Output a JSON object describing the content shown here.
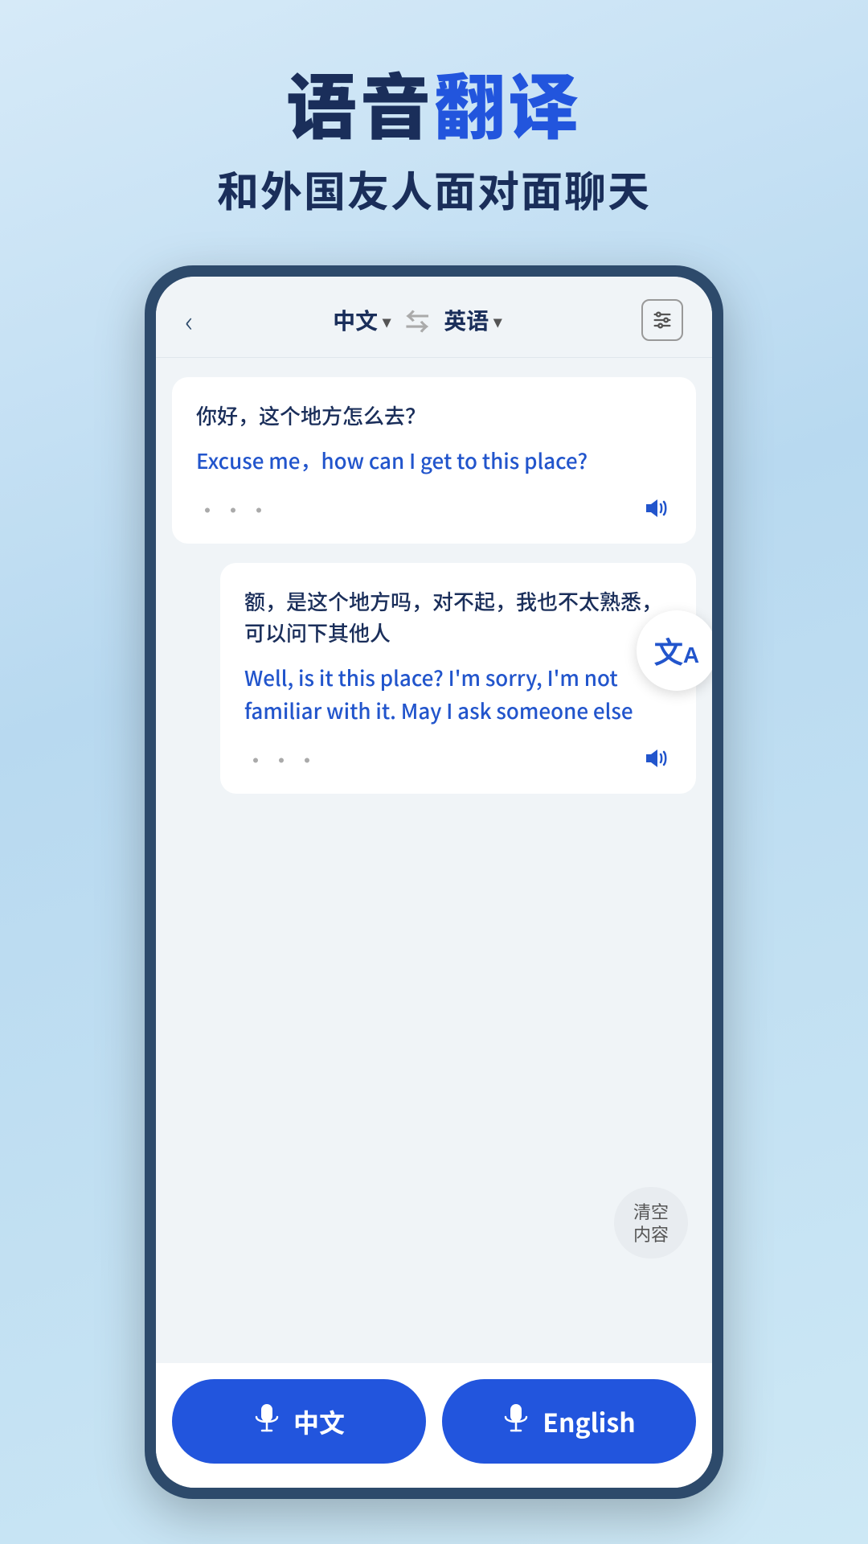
{
  "page": {
    "title": {
      "part1": "语音",
      "part2": "翻译",
      "subtitle": "和外国友人面对面聊天"
    }
  },
  "topBar": {
    "back_label": "‹",
    "lang1": "中文",
    "lang1_arrow": "▾",
    "lang2": "英语",
    "lang2_arrow": "▾",
    "swap_symbol": "⇄"
  },
  "messages": [
    {
      "id": 1,
      "original": "你好，这个地方怎么去？",
      "translated": "Excuse me，how can I get to this place?",
      "dots": "···",
      "alignment": "left"
    },
    {
      "id": 2,
      "original": "额，是这个地方吗，对不起，我也不太熟悉，可以问下其他人",
      "translated": "Well, is it this place? I'm sorry, I'm not familiar with it. May I ask someone else",
      "dots": "···",
      "alignment": "right"
    }
  ],
  "clearBtn": {
    "line1": "清空",
    "line2": "内容"
  },
  "bottomBtns": [
    {
      "id": "chinese",
      "label": "中文"
    },
    {
      "id": "english",
      "label": "English"
    }
  ],
  "translateBadge": {
    "symbol": "文A"
  }
}
